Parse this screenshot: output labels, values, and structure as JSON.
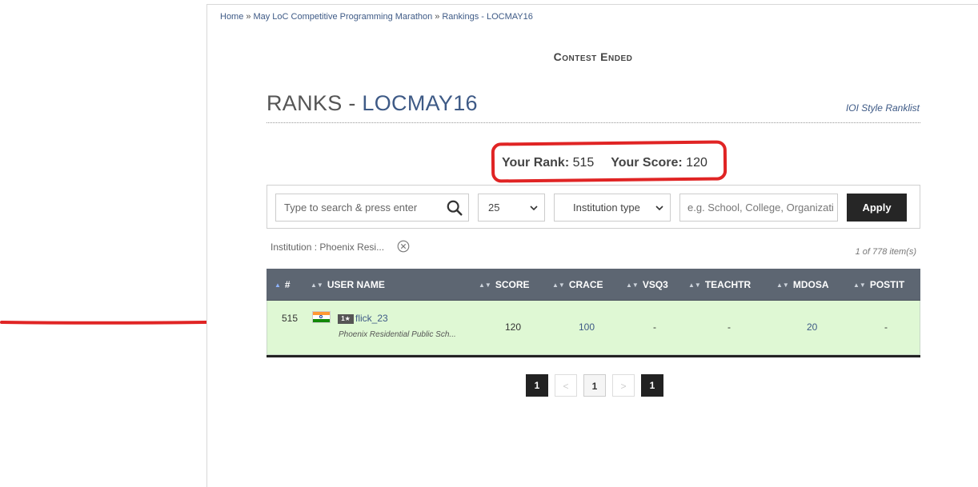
{
  "breadcrumb": {
    "items": [
      "Home",
      "May LoC Competitive Programming Marathon",
      "Rankings - LOCMAY16"
    ],
    "separator": "»"
  },
  "contest_status": "Contest Ended",
  "ranks_title": {
    "prefix": "RANKS - ",
    "code": "LOCMAY16"
  },
  "ioi_link": "IOI Style Ranklist",
  "rank_summary": {
    "rank_label": "Your Rank:",
    "rank_value": "515",
    "score_label": "Your Score:",
    "score_value": "120"
  },
  "filters": {
    "search_placeholder": "Type to search & press enter",
    "page_size": "25",
    "institution_type": "Institution type",
    "institution_placeholder": "e.g. School, College, Organizati",
    "apply_label": "Apply"
  },
  "active_filter": "Institution : Phoenix Resi...",
  "item_count": "1 of 778 item(s)",
  "table": {
    "columns": [
      "#",
      "USER NAME",
      "SCORE",
      "CRACE",
      "VSQ3",
      "TEACHTR",
      "MDOSA",
      "POSTIT"
    ],
    "rows": [
      {
        "rank": "515",
        "country_flag": "india-flag",
        "star_rating": "1★",
        "username": "flick_23",
        "institution": "Phoenix Residential Public Sch...",
        "score": "120",
        "crace": "100",
        "vsq3": "-",
        "teachtr": "-",
        "mdosa": "20",
        "postit": "-"
      }
    ]
  },
  "pagination": {
    "first": "1",
    "prev": "<",
    "current": "1",
    "next": ">",
    "last": "1"
  },
  "colors": {
    "accent": "#3e5a86",
    "header_bg": "#5d6672",
    "highlight_row": "#dff8d4",
    "annotation_red": "#e02424",
    "button_dark": "#262626"
  }
}
